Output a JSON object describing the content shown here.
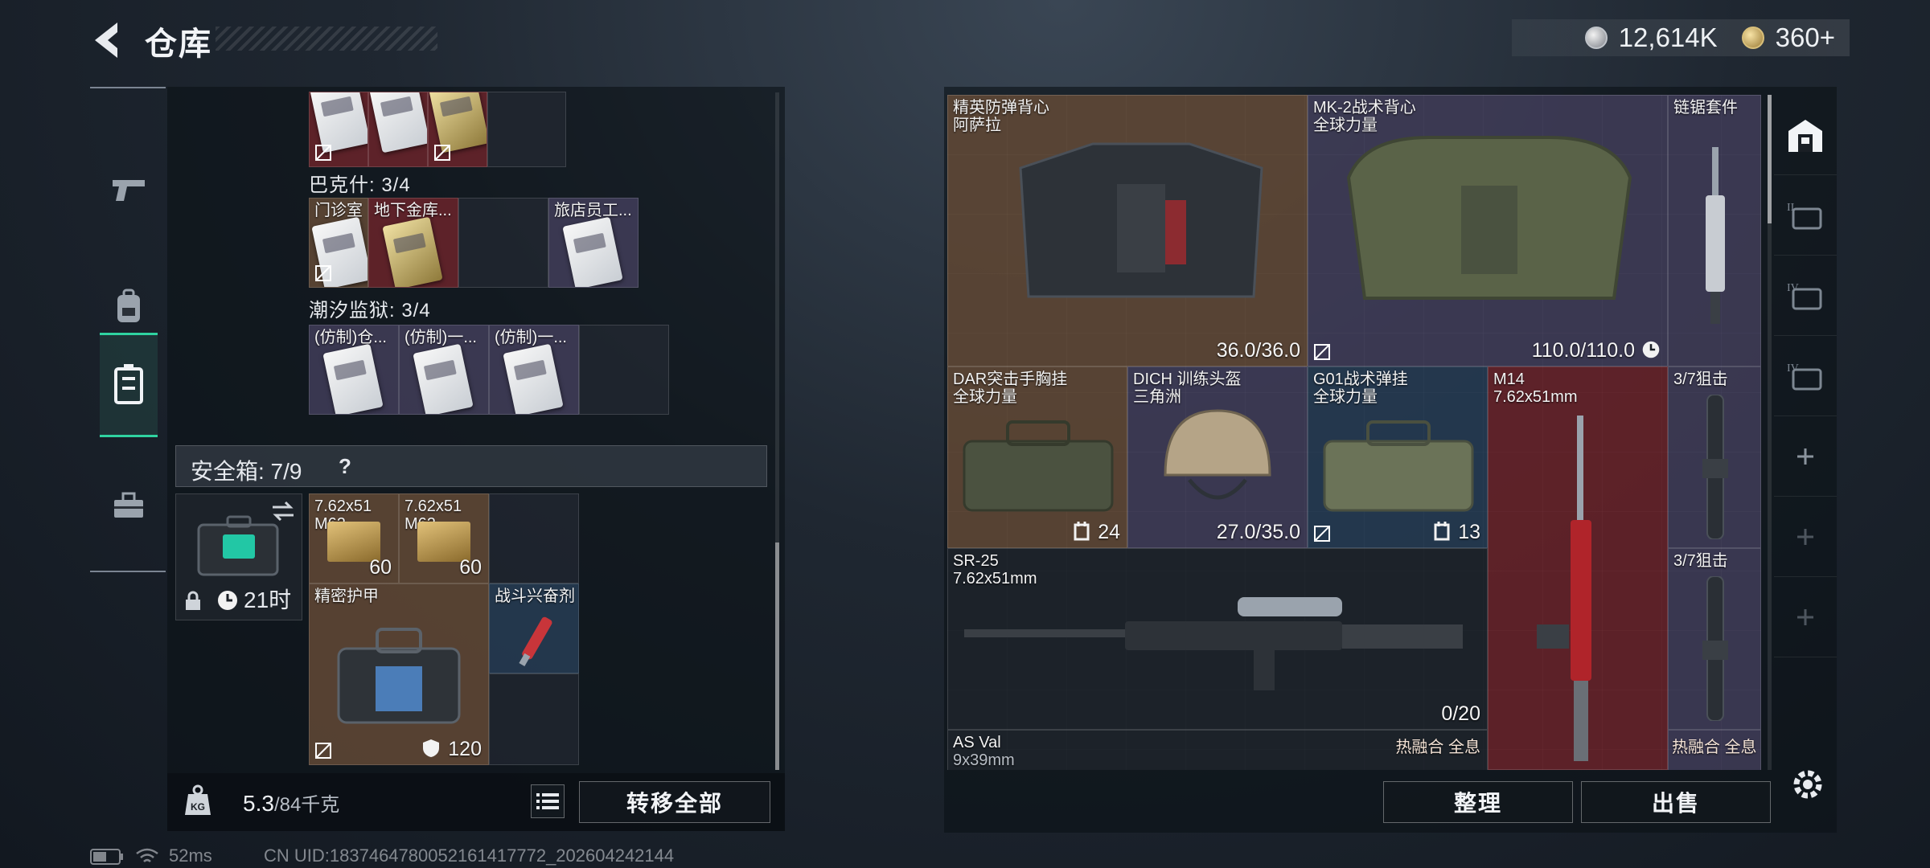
{
  "header": {
    "title": "仓库",
    "currency": [
      {
        "icon": "silver-coin-icon",
        "value": "12,614K"
      },
      {
        "icon": "gold-coin-icon",
        "value": "360+"
      }
    ]
  },
  "left": {
    "sections": [
      {
        "title": "巴克什: 3/4",
        "cards": [
          "门诊室",
          "地下金库...",
          "",
          "旅店员工..."
        ]
      },
      {
        "title": "潮汐监狱: 3/4",
        "cards": [
          "(仿制)仓...",
          "(仿制)一...",
          "(仿制)一...",
          ""
        ]
      }
    ],
    "safebox": {
      "title": "安全箱: 7/9",
      "help": "?",
      "timer": "21时",
      "items": [
        {
          "label1": "7.62x51",
          "label2": "M62",
          "count": "60"
        },
        {
          "label1": "7.62x51",
          "label2": "M62",
          "count": "60"
        },
        {
          "label1": "精密护甲",
          "label2": "",
          "count": "120"
        },
        {
          "label1": "战斗兴奋剂",
          "label2": "",
          "count": ""
        }
      ]
    },
    "weight": {
      "value": "5.3",
      "unit": "/84千克"
    },
    "transfer_all": "转移全部"
  },
  "right": {
    "items": [
      {
        "name": "精英防弹背心",
        "sub": "阿萨拉",
        "value": "36.0/36.0"
      },
      {
        "name": "MK-2战术背心",
        "sub": "全球力量",
        "value": "110.0/110.0"
      },
      {
        "name": "链锯套件",
        "sub": "",
        "value": ""
      },
      {
        "name": "DAR突击手胸挂",
        "sub": "全球力量",
        "value": "24"
      },
      {
        "name": "DICH 训练头盔",
        "sub": "三角洲",
        "value": "27.0/35.0"
      },
      {
        "name": "G01战术弹挂",
        "sub": "全球力量",
        "value": "13"
      },
      {
        "name": "M14",
        "sub": "7.62x51mm",
        "value": ""
      },
      {
        "name": "3/7狙击",
        "sub": "",
        "value": ""
      },
      {
        "name": "SR-25",
        "sub": "7.62x51mm",
        "value": "0/20"
      },
      {
        "name": "3/7狙击",
        "sub": "",
        "value": ""
      },
      {
        "name": "AS Val",
        "sub": "9x39mm",
        "value": ""
      }
    ],
    "heat_labels": [
      "热融合 全息",
      "热融合 全息"
    ],
    "sort": "整理",
    "sell": "出售"
  },
  "footer": {
    "ping": "52ms",
    "uid": "CN UID:1837464780052161417772_202604242144"
  },
  "colors": {
    "accent": "#2fd3a0",
    "rarity_red": "#7a262c",
    "rarity_gold": "#6e503a",
    "rarity_purple": "#4a4464",
    "rarity_blue": "#2a425c"
  }
}
